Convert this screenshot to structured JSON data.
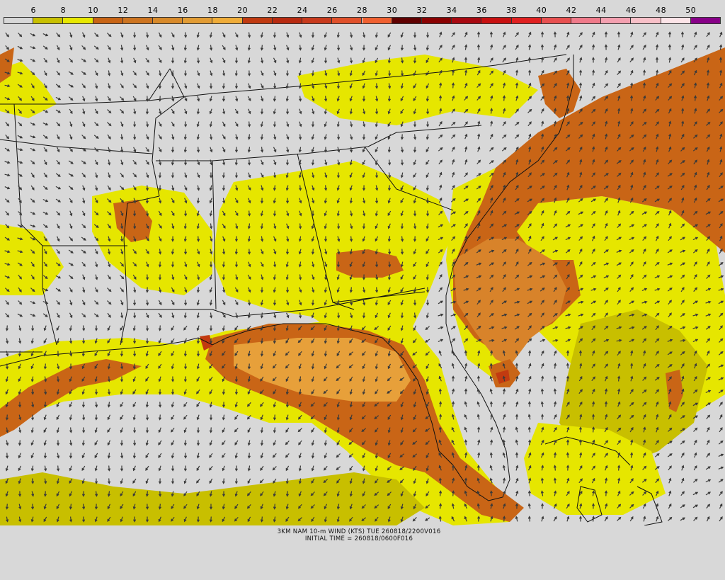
{
  "legend": {
    "ticks": [
      "6",
      "8",
      "10",
      "12",
      "14",
      "16",
      "18",
      "20",
      "22",
      "24",
      "26",
      "28",
      "30",
      "32",
      "34",
      "36",
      "38",
      "40",
      "42",
      "44",
      "46",
      "48",
      "50"
    ],
    "colors": [
      "#d8d8d8",
      "#c8c000",
      "#e8e800",
      "#c86414",
      "#cd7420",
      "#d88a2a",
      "#e29c34",
      "#efac38",
      "#c03a10",
      "#b82a10",
      "#c83a1c",
      "#e0502a",
      "#f06030",
      "#600000",
      "#8a0000",
      "#a80810",
      "#c81010",
      "#e02020",
      "#e85050",
      "#f07a8a",
      "#f4a0b0",
      "#f8c0c8",
      "#fce4e8",
      "#880088"
    ]
  },
  "caption": {
    "line1": "3KM NAM 10-m WIND (KTS) TUE 260818/2200V016",
    "line2": "INITIAL TIME = 260818/0600F016"
  },
  "map_colors": {
    "background": "#d8d8d8",
    "yellow": "#e6e600",
    "olive": "#c8bf00",
    "dark_orange": "#c96516",
    "mid_orange": "#d8832a",
    "light_orange": "#e7a03a",
    "red": "#c23a10",
    "arrow": "#3a3a3a",
    "border": "#111111"
  }
}
